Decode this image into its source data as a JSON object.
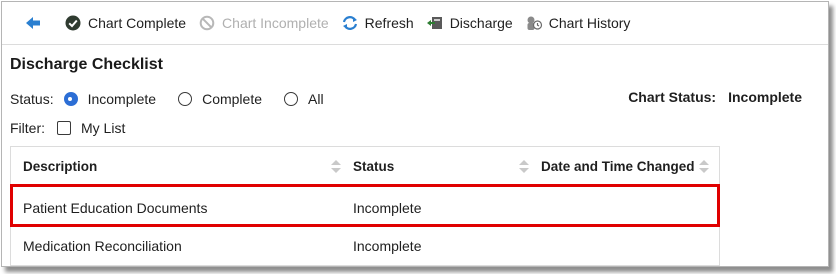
{
  "toolbar": {
    "back_icon": "back-arrow-icon",
    "chart_complete": "Chart Complete",
    "chart_incomplete": "Chart Incomplete",
    "refresh": "Refresh",
    "discharge": "Discharge",
    "chart_history": "Chart History"
  },
  "page": {
    "title": "Discharge Checklist",
    "status_label": "Status:",
    "status_options": [
      {
        "label": "Incomplete",
        "selected": true
      },
      {
        "label": "Complete",
        "selected": false
      },
      {
        "label": "All",
        "selected": false
      }
    ],
    "chart_status_label": "Chart Status:",
    "chart_status_value": "Incomplete",
    "filter_label": "Filter:",
    "filter_option": "My List"
  },
  "table": {
    "columns": [
      "Description",
      "Status",
      "Date and Time Changed"
    ],
    "rows": [
      {
        "description": "Patient Education Documents",
        "status": "Incomplete",
        "changed": ""
      },
      {
        "description": "Medication Reconciliation",
        "status": "Incomplete",
        "changed": ""
      }
    ]
  },
  "colors": {
    "accent": "#2c6ed5",
    "highlight": "#e00000",
    "disabled": "#b0b0b0"
  }
}
